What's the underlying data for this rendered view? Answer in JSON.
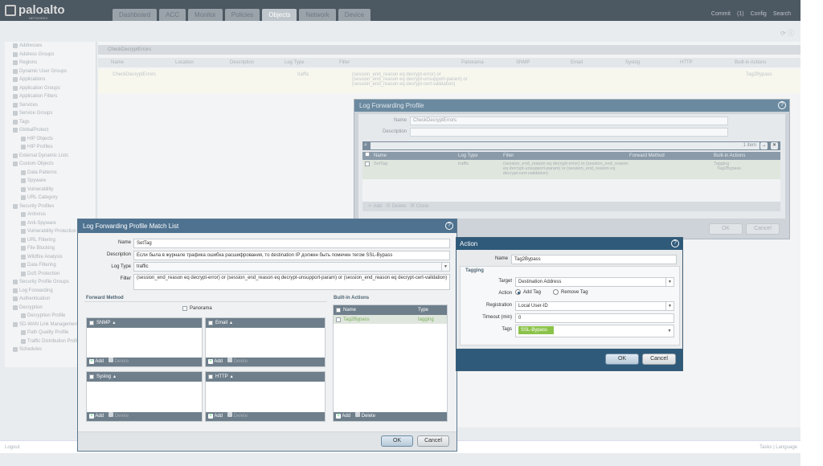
{
  "app": {
    "logo_text": "paloalto",
    "logo_sub": "NETWORKS",
    "tabs": [
      "Dashboard",
      "ACC",
      "Monitor",
      "Policies",
      "Objects",
      "Network",
      "Device"
    ],
    "active_tab": "Objects",
    "top_links": [
      "Commit",
      "(1)",
      "Config",
      "Search"
    ]
  },
  "sidebar": {
    "items": [
      "Addresses",
      "Address Groups",
      "Regions",
      "Dynamic User Groups",
      "Applications",
      "Application Groups",
      "Application Filters",
      "Services",
      "Service Groups",
      "Tags",
      "GlobalProtect",
      "HIP Objects",
      "HIP Profiles",
      "External Dynamic Lists",
      "Custom Objects",
      "Data Patterns",
      "Spyware",
      "Vulnerability",
      "URL Category",
      "Security Profiles",
      "Antivirus",
      "Anti-Spyware",
      "Vulnerability Protection",
      "URL Filtering",
      "File Blocking",
      "Wildfire Analysis",
      "Data Filtering",
      "DoS Protection",
      "Security Profile Groups",
      "Log Forwarding",
      "Authentication",
      "Decryption",
      "Decryption Profile",
      "SD-WAN Link Management",
      "Path Quality Profile",
      "Traffic Distribution Profile",
      "Schedules"
    ]
  },
  "content": {
    "search_value": "CheckDecryptErrors",
    "columns": [
      "Name",
      "Location",
      "Description",
      "Log Type",
      "Filter",
      "Panorama",
      "SNMP",
      "Email",
      "Syslog",
      "HTTP",
      "Built-in Actions"
    ],
    "row": {
      "name": "CheckDecryptErrors",
      "log_type": "traffic",
      "filter": "(session_end_reason eq decrypt-error) or (session_end_reason eq decrypt-unsupport-param) or (session_end_reason eq decrypt-cert-validation)",
      "action": "Tag2Bypass"
    }
  },
  "bottombar": {
    "left": "Logout",
    "right": "Tasks | Language"
  },
  "lfp": {
    "title": "Log Forwarding Profile",
    "name_label": "Name",
    "name_value": "CheckDecryptErrors",
    "description_label": "Description",
    "count": "1 item",
    "columns": [
      "Name",
      "Log Type",
      "Filter",
      "Forward Method",
      "Built-in Actions"
    ],
    "row": {
      "name": "SetTag",
      "log_type": "traffic",
      "filter": "(session_end_reason eq decrypt-error) or (session_end_reason eq decrypt-unsupport-param) or (session_end_reason eq decrypt-cert-validation)",
      "actions_head": "Tagging",
      "action": "Tag2Bypass"
    },
    "footer": [
      "Add",
      "Delete",
      "Clone"
    ],
    "ok": "OK",
    "cancel": "Cancel"
  },
  "matchlist": {
    "title": "Log Forwarding Profile Match List",
    "name_label": "Name",
    "name_value": "SetTag",
    "description_label": "Description",
    "description_value": "Если была в журнале трафика ошибка расшифрования, то destination IP должен быть помечен тегом SSL-Bypass",
    "logtype_label": "Log Type",
    "logtype_value": "traffic",
    "filter_label": "Filter",
    "filter_value": "(session_end_reason eq decrypt-error) or (session_end_reason eq decrypt-unsupport-param) or (session_end_reason eq decrypt-cert-validation)",
    "forward_method": "Forward Method",
    "panorama": "Panorama",
    "snmp": "SNMP",
    "email": "Email",
    "syslog": "Syslog",
    "http": "HTTP",
    "add": "Add",
    "delete": "Delete",
    "builtin_title": "Built-in Actions",
    "builtin_col_name": "Name",
    "builtin_col_type": "Type",
    "builtin_row_name": "Tag2Bypass",
    "builtin_row_type": "tagging",
    "ok": "OK",
    "cancel": "Cancel"
  },
  "action": {
    "title": "Action",
    "name_label": "Name",
    "name_value": "Tag2Bypass",
    "tagging": "Tagging",
    "target_label": "Target",
    "target_value": "Destination Address",
    "action_label": "Action",
    "add_tag": "Add Tag",
    "remove_tag": "Remove Tag",
    "registration_label": "Registration",
    "registration_value": "Local User-ID",
    "timeout_label": "Timeout (min)",
    "timeout_value": "0",
    "tags_label": "Tags",
    "tag_value": "SSL-Bypass",
    "ok": "OK",
    "cancel": "Cancel"
  }
}
